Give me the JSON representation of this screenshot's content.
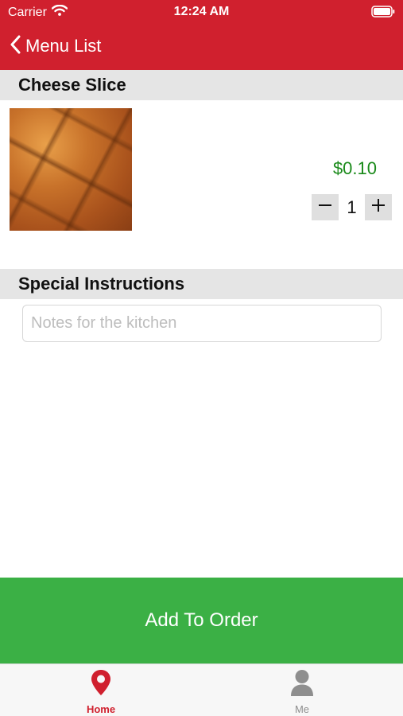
{
  "status_bar": {
    "carrier": "Carrier",
    "time": "12:24 AM",
    "icons": [
      "wifi-icon",
      "battery-icon"
    ]
  },
  "nav": {
    "back_label": "Menu List",
    "back_icon": "chevron-left-icon"
  },
  "item": {
    "name": "Cheese Slice",
    "price": "$0.10",
    "quantity": "1",
    "image_description": "pizza-slice-photo"
  },
  "instructions": {
    "header": "Special Instructions",
    "placeholder": "Notes for the kitchen",
    "value": ""
  },
  "actions": {
    "add_to_order": "Add To Order"
  },
  "tab_bar": {
    "items": [
      {
        "label": "Home",
        "icon": "map-pin-icon",
        "active": true
      },
      {
        "label": "Me",
        "icon": "user-icon",
        "active": false
      }
    ]
  },
  "colors": {
    "brand": "#d0202e",
    "price": "#1a8a1a",
    "add_button": "#3bb045",
    "section_bg": "#e5e5e5"
  }
}
